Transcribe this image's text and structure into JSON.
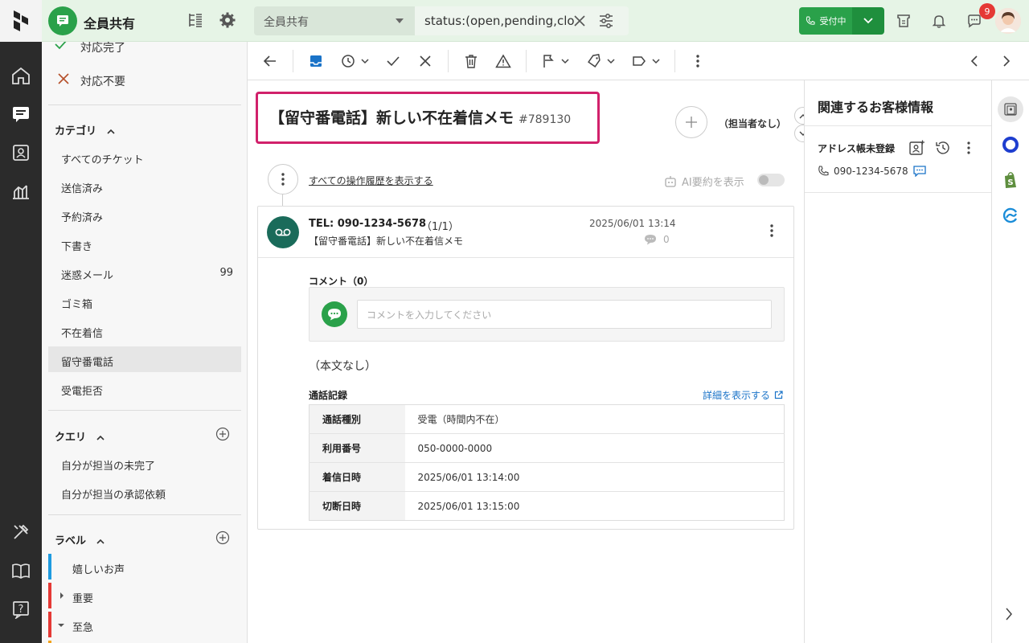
{
  "topbar": {
    "inbox_title": "全員共有",
    "filter_select": "全員共有",
    "filter_query": "status:(open,pending,clo",
    "status_button": "受付中",
    "notification_count": "9"
  },
  "sidebar": {
    "status_items": [
      {
        "label": "対応完了"
      },
      {
        "label": "対応不要"
      }
    ],
    "category_header": "カテゴリ",
    "category_items": [
      {
        "label": "すべてのチケット",
        "count": ""
      },
      {
        "label": "送信済み",
        "count": ""
      },
      {
        "label": "予約済み",
        "count": ""
      },
      {
        "label": "下書き",
        "count": ""
      },
      {
        "label": "迷惑メール",
        "count": "99"
      },
      {
        "label": "ゴミ箱",
        "count": ""
      },
      {
        "label": "不在着信",
        "count": ""
      },
      {
        "label": "留守番電話",
        "count": ""
      },
      {
        "label": "受電拒否",
        "count": ""
      }
    ],
    "query_header": "クエリ",
    "query_items": [
      {
        "label": "自分が担当の未完了"
      },
      {
        "label": "自分が担当の承認依頼"
      }
    ],
    "label_header": "ラベル",
    "label_items": [
      {
        "label": "嬉しいお声",
        "color": "#1e9be0"
      },
      {
        "label": "重要",
        "color": "#e53935"
      },
      {
        "label": "至急",
        "color": "#e53935"
      }
    ]
  },
  "ticket": {
    "title": "【留守番電話】新しい不在着信メモ",
    "id": "#789130",
    "assignee": "（担当者なし）",
    "history_link": "すべての操作履歴を表示する",
    "ai_summary": "AI要約を表示"
  },
  "message": {
    "from": "TEL: 090-1234-5678",
    "count": "（1/1）",
    "subject": "【留守番電話】新しい不在着信メモ",
    "date": "2025/06/01 13:14",
    "comment_count": "0",
    "comment_title": "コメント（0）",
    "comment_placeholder": "コメントを入力してください",
    "body": "（本文なし）",
    "call_log_title": "通話記録",
    "detail_link": "詳細を表示する",
    "call_log": [
      {
        "key": "通話種別",
        "value": "受電（時間内不在）"
      },
      {
        "key": "利用番号",
        "value": "050-0000-0000"
      },
      {
        "key": "着信日時",
        "value": "2025/06/01 13:14:00"
      },
      {
        "key": "切断日時",
        "value": "2025/06/01 13:15:00"
      }
    ]
  },
  "customer": {
    "title": "関連するお客様情報",
    "address_status": "アドレス帳未登録",
    "phone": "090-1234-5678"
  },
  "colors": {
    "brand_green": "#2aa14a",
    "highlight_border": "#d1216b",
    "rail_bg": "#2b2b2b"
  }
}
